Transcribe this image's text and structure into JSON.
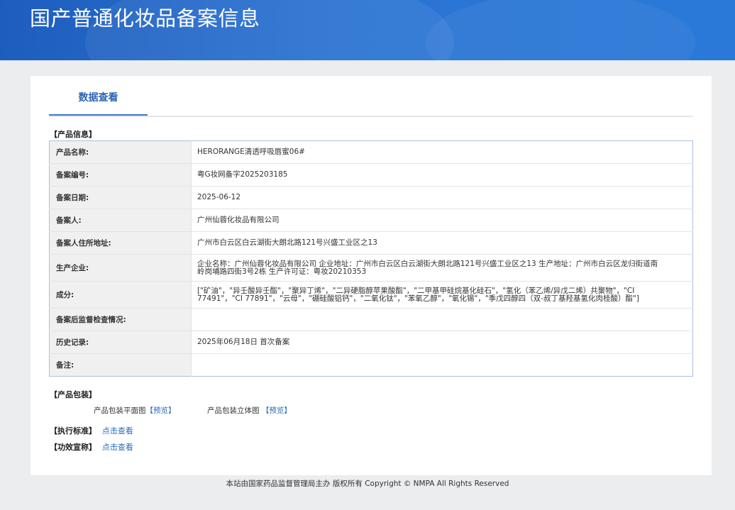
{
  "header": {
    "title": "国产普通化妆品备案信息"
  },
  "tabs": [
    {
      "label": "数据查看",
      "active": true
    }
  ],
  "product_info": {
    "section_title": "【产品信息】",
    "rows": [
      {
        "label": "产品名称:",
        "value": "HERORANGE清透呼吸唇蜜06#"
      },
      {
        "label": "备案编号:",
        "value": "粤G妆网备字2025203185"
      },
      {
        "label": "备案日期:",
        "value": "2025-06-12"
      },
      {
        "label": "备案人:",
        "value": "广州仙蓉化妆品有限公司"
      },
      {
        "label": "备案人住所地址:",
        "value": "广州市白云区白云湖街大朗北路121号兴盛工业区之13"
      },
      {
        "label": "生产企业:",
        "value": "企业名称：广州仙蓉化妆品有限公司 企业地址：广州市白云区白云湖街大朗北路121号兴盛工业区之13 生产地址：广州市白云区龙归街道南岭岗埔路四街3号2栋 生产许可证：粤妆20210353"
      },
      {
        "label": "成分:",
        "value": "[\"矿油\"，\"异壬酸异壬酯\"，\"聚异丁烯\"，\"二异硬脂醇苹果酸酯\"，\"二甲基甲硅烷基化硅石\"，\"氢化（苯乙烯/异戊二烯）共聚物\"，\"CI 77491\"，\"CI 77891\"，\"云母\"，\"硼硅酸铝钙\"，\"二氧化钛\"，\"苯氧乙醇\"，\"氧化锡\"，\"季戊四醇四（双-叔丁基羟基氢化肉桂酸）酯\"]"
      },
      {
        "label": "备案后监督检查情况:",
        "value": ""
      },
      {
        "label": "历史记录:",
        "value": "2025年06月18日 首次备案"
      },
      {
        "label": "备注:",
        "value": ""
      }
    ]
  },
  "packaging": {
    "section_title": "【产品包装】",
    "flat_label": "产品包装平面图",
    "flat_link": "【预览】",
    "stereo_label": "产品包装立体图",
    "stereo_link": "【预览】"
  },
  "standard": {
    "label": "【执行标准】",
    "link": "点击查看"
  },
  "efficacy": {
    "label": "【功效宣称】",
    "link": "点击查看"
  },
  "footer": {
    "text": "本站由国家药品监督管理局主办 版权所有 Copyright © NMPA All Rights Reserved"
  },
  "colors": {
    "header_blue": "#2b73d2",
    "link_blue": "#2a6bb8",
    "tab_active": "#2a65b5"
  }
}
